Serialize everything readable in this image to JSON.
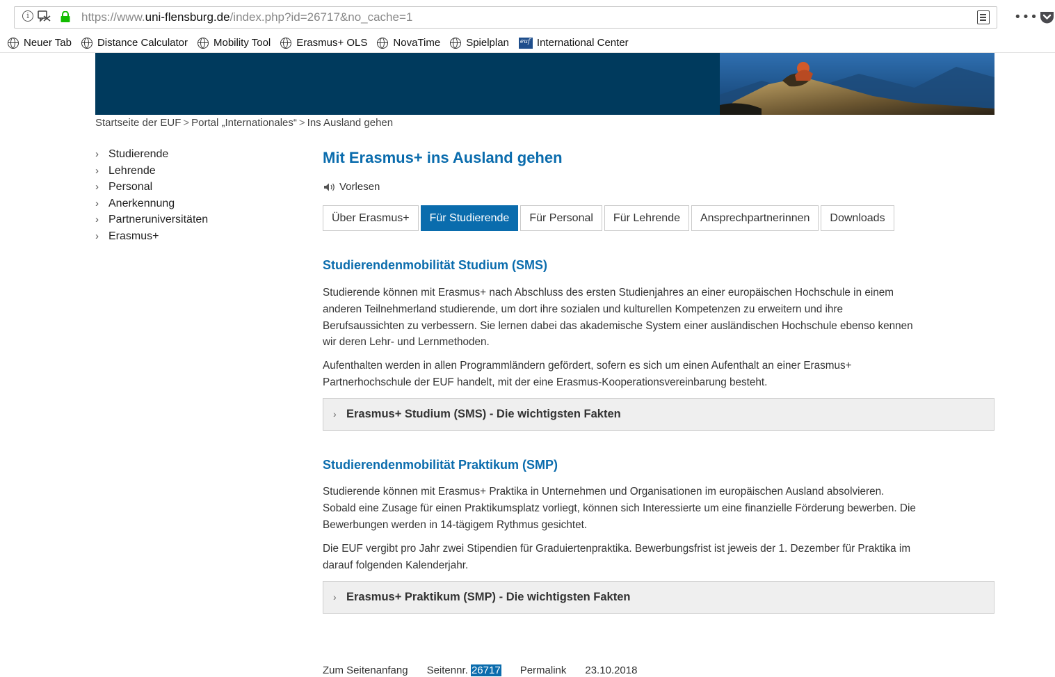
{
  "browser": {
    "url_prefix": "https://www.",
    "url_domain": "uni-flensburg.de",
    "url_path": "/index.php?id=26717&no_cache=1",
    "more_label": "•••"
  },
  "bookmarks": [
    {
      "label": "Neuer Tab",
      "icon": "globe-icon"
    },
    {
      "label": "Distance Calculator",
      "icon": "globe-icon"
    },
    {
      "label": "Mobility Tool",
      "icon": "globe-icon"
    },
    {
      "label": "Erasmus+ OLS",
      "icon": "globe-icon"
    },
    {
      "label": "NovaTime",
      "icon": "globe-icon"
    },
    {
      "label": "Spielplan",
      "icon": "globe-icon"
    },
    {
      "label": "International Center",
      "icon": "euf-icon"
    }
  ],
  "breadcrumb": {
    "items": [
      "Startseite der EUF",
      "Portal „Internationales“",
      "Ins Ausland gehen"
    ],
    "separator": ">"
  },
  "sidenav": {
    "items": [
      "Studierende",
      "Lehrende",
      "Personal",
      "Anerkennung",
      "Partneruniversitäten",
      "Erasmus+"
    ]
  },
  "main": {
    "title": "Mit Erasmus+ ins Ausland gehen",
    "readaloud": "Vorlesen",
    "tabs": [
      {
        "label": "Über Erasmus+",
        "active": false
      },
      {
        "label": "Für Studierende",
        "active": true
      },
      {
        "label": "Für Personal",
        "active": false
      },
      {
        "label": "Für Lehrende",
        "active": false
      },
      {
        "label": "Ansprechpartnerinnen",
        "active": false
      },
      {
        "label": "Downloads",
        "active": false
      }
    ],
    "sms": {
      "heading": "Studierendenmobilität Studium (SMS)",
      "p1_lines": [
        "Studierende können mit Erasmus+ nach Abschluss des ersten Studienjahres an einer europäischen Hochschule in einem",
        "anderen Teilnehmerland studierende, um dort ihre sozialen und kulturellen Kompetenzen zu erweitern und ihre",
        "Berufsaussichten zu verbessern. Sie lernen dabei das akademische System einer ausländischen Hochschule ebenso kennen",
        "wir deren Lehr- und Lernmethoden."
      ],
      "p2_lines": [
        "Aufenthalten werden in allen Programmländern gefördert, sofern es sich um einen Aufenthalt an einer Erasmus+",
        "Partnerhochschule der EUF handelt, mit der eine Erasmus-Kooperationsvereinbarung besteht."
      ],
      "accordion": "Erasmus+ Studium (SMS) - Die wichtigsten Fakten"
    },
    "smp": {
      "heading": "Studierendenmobilität Praktikum (SMP)",
      "p1_lines": [
        "Studierende können mit Erasmus+ Praktika in Unternehmen und Organisationen im europäischen Ausland absolvieren.",
        "Sobald eine Zusage für einen Praktikumsplatz vorliegt, können sich Interessierte um eine finanzielle Förderung bewerben. Die",
        "Bewerbungen werden in 14-tägigem Rythmus gesichtet."
      ],
      "p2_lines": [
        "Die EUF vergibt pro Jahr zwei Stipendien für Graduiertenpraktika. Bewerbungsfrist ist jeweis der 1. Dezember für Praktika im",
        "darauf folgenden Kalenderjahr."
      ],
      "accordion": "Erasmus+ Praktikum (SMP) - Die wichtigsten Fakten"
    }
  },
  "footer": {
    "top_link": "Zum Seitenanfang",
    "page_no_label": "Seitennr.",
    "page_no": "26717",
    "permalink": "Permalink",
    "date": "23.10.2018"
  },
  "colors": {
    "accent": "#0a6cad",
    "banner": "#003a5d"
  }
}
